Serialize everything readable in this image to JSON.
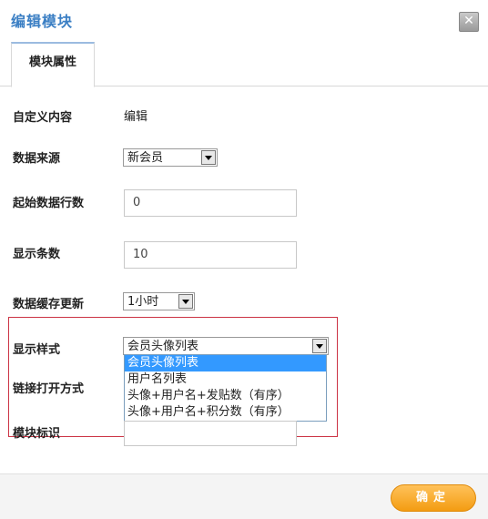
{
  "dialog": {
    "title": "编辑模块",
    "close_icon": "close-icon",
    "close_glyph": "✕"
  },
  "tabs": [
    {
      "label": "模块属性",
      "active": true
    }
  ],
  "form": {
    "custom_content": {
      "label": "自定义内容",
      "value": "编辑"
    },
    "data_source": {
      "label": "数据来源",
      "selected": "新会员"
    },
    "start_row": {
      "label": "起始数据行数",
      "value": "0"
    },
    "display_count": {
      "label": "显示条数",
      "value": "10"
    },
    "cache_update": {
      "label": "数据缓存更新",
      "selected": "1小时"
    },
    "display_style": {
      "label": "显示样式",
      "selected": "会员头像列表",
      "options": [
        "会员头像列表",
        "用户名列表",
        "头像+用户名+发贴数（有序）",
        "头像+用户名+积分数（有序）"
      ]
    },
    "link_open_mode": {
      "label": "链接打开方式"
    },
    "module_id": {
      "label": "模块标识",
      "value": ""
    }
  },
  "footer": {
    "confirm_label": "确定"
  },
  "colors": {
    "title": "#3b7fc4",
    "highlight_border": "#cc3344",
    "dropdown_selected": "#3399ff",
    "confirm_button": "#f39c12"
  }
}
